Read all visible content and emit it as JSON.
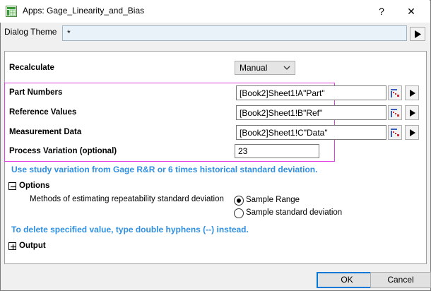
{
  "window": {
    "title": "Apps: Gage_Linearity_and_Bias",
    "help_label": "?",
    "close_label": "✕"
  },
  "theme": {
    "label": "Dialog Theme",
    "value": "*"
  },
  "recalculate": {
    "label": "Recalculate",
    "value": "Manual"
  },
  "inputs": {
    "part_numbers": {
      "label": "Part Numbers",
      "value": "[Book2]Sheet1!A\"Part\""
    },
    "reference_values": {
      "label": "Reference Values",
      "value": "[Book2]Sheet1!B\"Ref\""
    },
    "measurement_data": {
      "label": "Measurement Data",
      "value": "[Book2]Sheet1!C\"Data\""
    },
    "process_variation": {
      "label": "Process Variation (optional)",
      "value": "23"
    }
  },
  "hints": {
    "study_variation": "Use study variation from Gage R&R or 6 times historical standard deviation.",
    "delete_value": "To delete specified value, type double hyphens (--) instead."
  },
  "options": {
    "label": "Options",
    "toggle": "minus",
    "methods_label": "Methods of estimating repeatability standard deviation",
    "radio_range": "Sample Range",
    "radio_sd": "Sample standard deviation",
    "selected": "Sample Range"
  },
  "output": {
    "label": "Output",
    "toggle": "plus"
  },
  "buttons": {
    "ok": "OK",
    "cancel": "Cancel"
  },
  "colors": {
    "highlight_box": "#e040e0",
    "hint_text": "#2f8fe0",
    "default_button_border": "#0078d7"
  }
}
